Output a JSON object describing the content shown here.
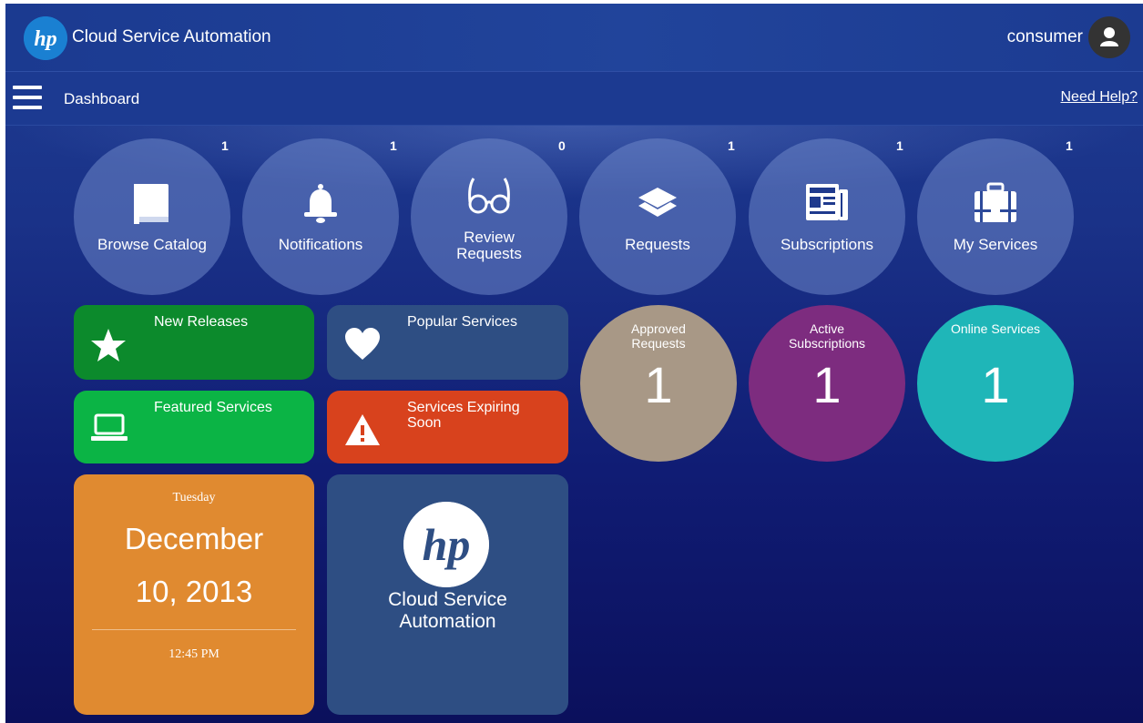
{
  "header": {
    "app_title": "Cloud Service Automation",
    "username": "consumer",
    "logo_text": "hp"
  },
  "navbar": {
    "page_title": "Dashboard",
    "help_link": "Need Help?"
  },
  "nav_circles": [
    {
      "label": "Browse Catalog",
      "badge": "1",
      "icon": "book-icon"
    },
    {
      "label": "Notifications",
      "badge": "1",
      "icon": "bell-icon"
    },
    {
      "label": "Review Requests",
      "badge": "0",
      "icon": "glasses-icon"
    },
    {
      "label": "Requests",
      "badge": "1",
      "icon": "layers-icon"
    },
    {
      "label": "Subscriptions",
      "badge": "1",
      "icon": "newspaper-icon"
    },
    {
      "label": "My Services",
      "badge": "1",
      "icon": "briefcase-icon"
    }
  ],
  "tiles": {
    "new_releases": {
      "label": "New Releases",
      "icon": "star-icon",
      "color": "#0c8a2c"
    },
    "popular_services": {
      "label": "Popular Services",
      "icon": "heart-icon",
      "color": "#2e4e83"
    },
    "featured_services": {
      "label": "Featured Services",
      "icon": "laptop-icon",
      "color": "#0bb445"
    },
    "services_expiring": {
      "label": "Services Expiring Soon",
      "icon": "warning-icon",
      "color": "#d8421d"
    }
  },
  "stats": [
    {
      "label": "Approved Requests",
      "value": "1",
      "color": "#a89886"
    },
    {
      "label": "Active Subscriptions",
      "value": "1",
      "color": "#7d2c7f"
    },
    {
      "label": "Online Services",
      "value": "1",
      "color": "#1fb6b8"
    }
  ],
  "date_tile": {
    "day": "Tuesday",
    "month": "December",
    "day_year": "10, 2013",
    "time": "12:45 PM"
  },
  "brand_tile": {
    "name": "Cloud Service Automation",
    "logo_text": "hp"
  }
}
